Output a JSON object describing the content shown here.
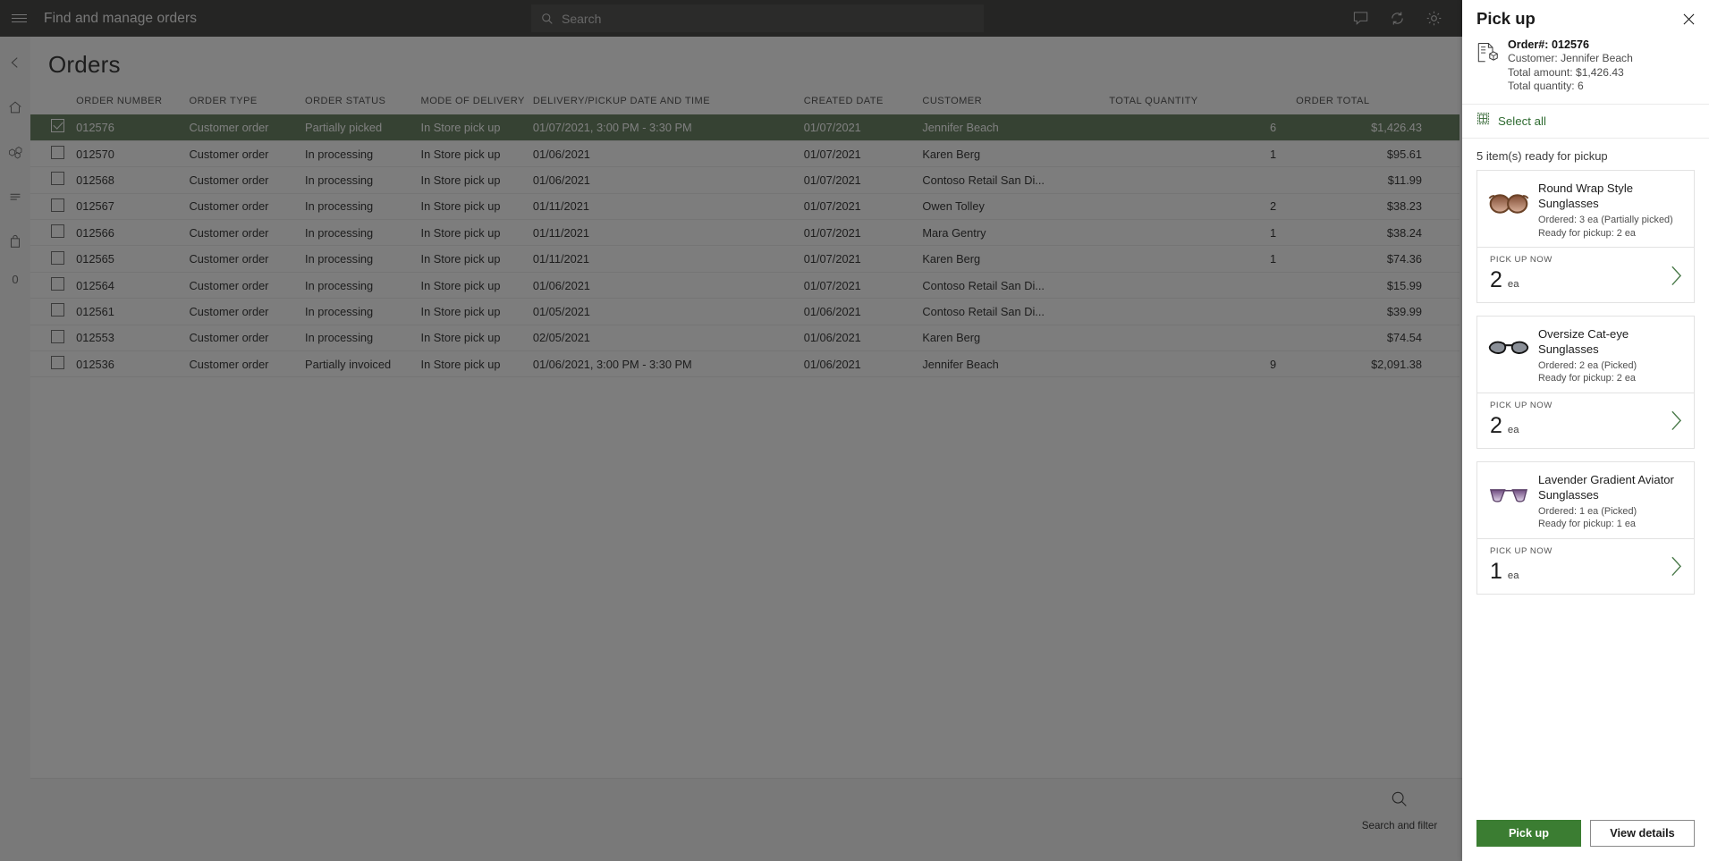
{
  "topbar": {
    "app_title": "Find and manage orders",
    "search_placeholder": "Search",
    "icons": [
      "hamburger-icon",
      "search-icon",
      "note-icon",
      "refresh-icon",
      "gear-icon"
    ]
  },
  "sidebar": {
    "items": [
      {
        "name": "back-icon",
        "label": "Back"
      },
      {
        "name": "home-icon",
        "label": "Home"
      },
      {
        "name": "products-icon",
        "label": "Products"
      },
      {
        "name": "lines-icon",
        "label": "Transactions"
      },
      {
        "name": "bag-icon",
        "label": "Cart"
      },
      {
        "name": "cart-count",
        "label": "0"
      }
    ]
  },
  "page": {
    "title": "Orders"
  },
  "grid": {
    "columns": [
      "ORDER NUMBER",
      "ORDER TYPE",
      "ORDER STATUS",
      "MODE OF DELIVERY",
      "DELIVERY/PICKUP DATE AND TIME",
      "CREATED DATE",
      "CUSTOMER",
      "TOTAL QUANTITY",
      "ORDER TOTAL"
    ],
    "rows": [
      {
        "selected": true,
        "order_number": "012576",
        "order_type": "Customer order",
        "order_status": "Partially picked",
        "mode_of_delivery": "In Store pick up",
        "delivery_datetime": "01/07/2021, 3:00 PM - 3:30 PM",
        "created_date": "01/07/2021",
        "customer": "Jennifer Beach",
        "total_quantity": "6",
        "order_total": "$1,426.43"
      },
      {
        "selected": false,
        "order_number": "012570",
        "order_type": "Customer order",
        "order_status": "In processing",
        "mode_of_delivery": "In Store pick up",
        "delivery_datetime": "01/06/2021",
        "created_date": "01/07/2021",
        "customer": "Karen Berg",
        "total_quantity": "1",
        "order_total": "$95.61"
      },
      {
        "selected": false,
        "order_number": "012568",
        "order_type": "Customer order",
        "order_status": "In processing",
        "mode_of_delivery": "In Store pick up",
        "delivery_datetime": "01/06/2021",
        "created_date": "01/07/2021",
        "customer": "Contoso Retail San Di...",
        "total_quantity": "",
        "order_total": "$11.99"
      },
      {
        "selected": false,
        "order_number": "012567",
        "order_type": "Customer order",
        "order_status": "In processing",
        "mode_of_delivery": "In Store pick up",
        "delivery_datetime": "01/11/2021",
        "created_date": "01/07/2021",
        "customer": "Owen Tolley",
        "total_quantity": "2",
        "order_total": "$38.23"
      },
      {
        "selected": false,
        "order_number": "012566",
        "order_type": "Customer order",
        "order_status": "In processing",
        "mode_of_delivery": "In Store pick up",
        "delivery_datetime": "01/11/2021",
        "created_date": "01/07/2021",
        "customer": "Mara Gentry",
        "total_quantity": "1",
        "order_total": "$38.24"
      },
      {
        "selected": false,
        "order_number": "012565",
        "order_type": "Customer order",
        "order_status": "In processing",
        "mode_of_delivery": "In Store pick up",
        "delivery_datetime": "01/11/2021",
        "created_date": "01/07/2021",
        "customer": "Karen Berg",
        "total_quantity": "1",
        "order_total": "$74.36"
      },
      {
        "selected": false,
        "order_number": "012564",
        "order_type": "Customer order",
        "order_status": "In processing",
        "mode_of_delivery": "In Store pick up",
        "delivery_datetime": "01/06/2021",
        "created_date": "01/07/2021",
        "customer": "Contoso Retail San Di...",
        "total_quantity": "",
        "order_total": "$15.99"
      },
      {
        "selected": false,
        "order_number": "012561",
        "order_type": "Customer order",
        "order_status": "In processing",
        "mode_of_delivery": "In Store pick up",
        "delivery_datetime": "01/05/2021",
        "created_date": "01/06/2021",
        "customer": "Contoso Retail San Di...",
        "total_quantity": "",
        "order_total": "$39.99"
      },
      {
        "selected": false,
        "order_number": "012553",
        "order_type": "Customer order",
        "order_status": "In processing",
        "mode_of_delivery": "In Store pick up",
        "delivery_datetime": "02/05/2021",
        "created_date": "01/06/2021",
        "customer": "Karen Berg",
        "total_quantity": "",
        "order_total": "$74.54"
      },
      {
        "selected": false,
        "order_number": "012536",
        "order_type": "Customer order",
        "order_status": "Partially invoiced",
        "mode_of_delivery": "In Store pick up",
        "delivery_datetime": "01/06/2021, 3:00 PM - 3:30 PM",
        "created_date": "01/06/2021",
        "customer": "Jennifer Beach",
        "total_quantity": "9",
        "order_total": "$2,091.38"
      }
    ]
  },
  "commandbar": {
    "search_filter_label": "Search and filter"
  },
  "panel": {
    "title": "Pick up",
    "close_label": "Close",
    "order": {
      "order_number_line": "Order#: 012576",
      "customer_line": "Customer: Jennifer Beach",
      "total_amount_line": "Total amount: $1,426.43",
      "total_quantity_line": "Total quantity: 6"
    },
    "select_all_label": "Select all",
    "ready_label": "5 item(s) ready for pickup",
    "items": [
      {
        "name": "Round Wrap Style Sunglasses",
        "ordered": "Ordered: 3 ea (Partially picked)",
        "ready": "Ready for pickup: 2 ea",
        "qty_label": "PICK UP NOW",
        "qty_value": "2",
        "qty_unit": "ea",
        "thumb": "round-wrap-sunglasses"
      },
      {
        "name": "Oversize Cat-eye Sunglasses",
        "ordered": "Ordered: 2 ea (Picked)",
        "ready": "Ready for pickup: 2 ea",
        "qty_label": "PICK UP NOW",
        "qty_value": "2",
        "qty_unit": "ea",
        "thumb": "cateye-sunglasses"
      },
      {
        "name": "Lavender Gradient Aviator Sunglasses",
        "ordered": "Ordered: 1 ea (Picked)",
        "ready": "Ready for pickup: 1 ea",
        "qty_label": "PICK UP NOW",
        "qty_value": "1",
        "qty_unit": "ea",
        "thumb": "aviator-sunglasses"
      }
    ],
    "footer": {
      "primary_label": "Pick up",
      "secondary_label": "View details"
    }
  },
  "colors": {
    "accent_green": "#3b7d32",
    "selected_row": "#6c8566",
    "topbar": "#4a4a48",
    "link_green": "#2f6b31"
  }
}
